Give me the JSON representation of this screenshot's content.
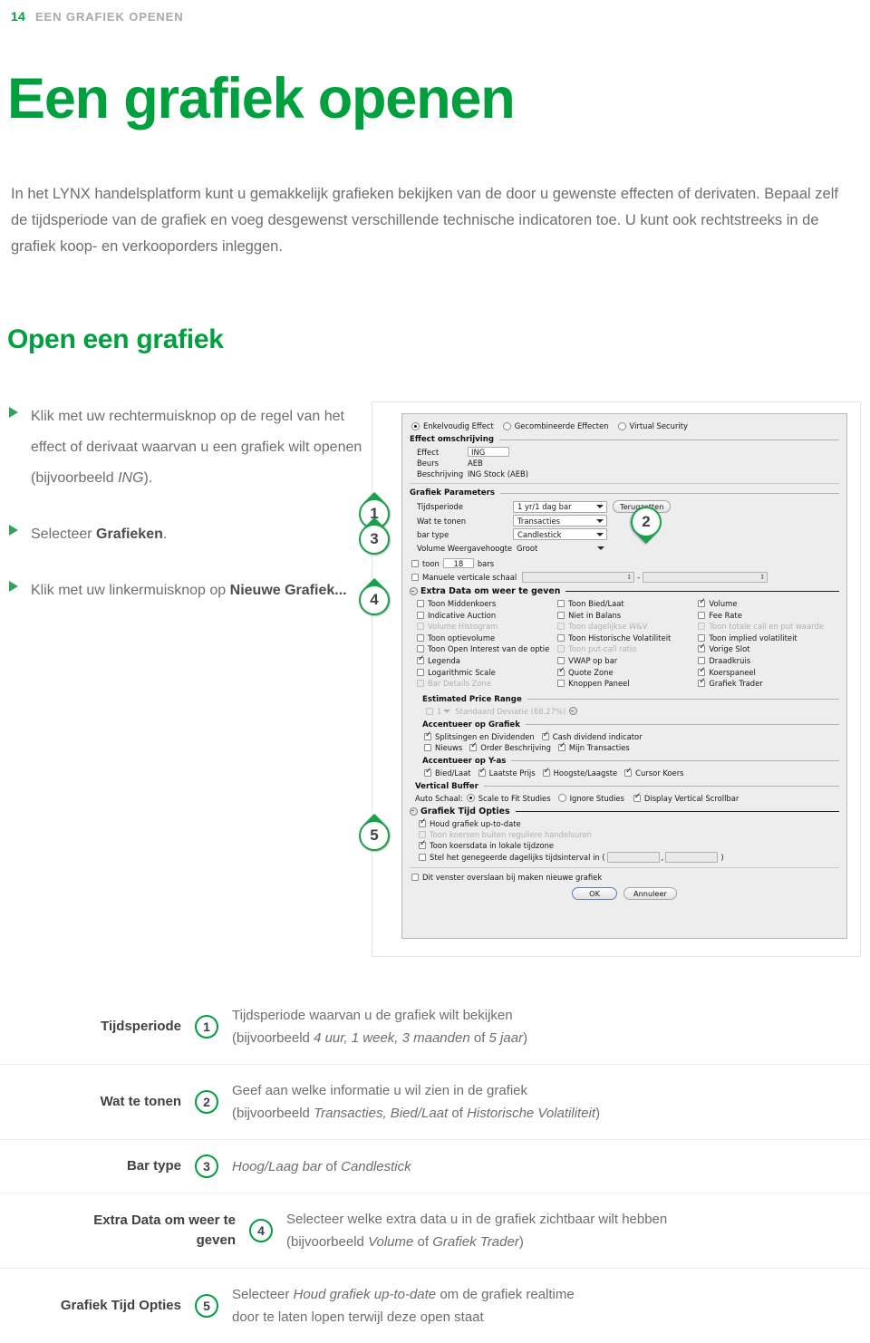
{
  "runhead": {
    "page_number": "14",
    "title": "EEN GRAFIEK OPENEN"
  },
  "page_title": "Een grafiek openen",
  "intro": "In het LYNX handelsplatform kunt u gemakkelijk grafieken bekijken van de door u gewenste effecten of derivaten. Bepaal zelf de tijdsperiode van de grafiek en voeg desgewenst verschillende technische indicatoren toe. U kunt ook rechtstreeks in de grafiek koop- en verkooporders inleggen.",
  "section_head": "Open een grafiek",
  "bullets": [
    {
      "pre": "Klik met uw rechtermuisknop op de regel van het effect of derivaat waarvan u een grafiek wilt openen (bijvoorbeeld ",
      "em": "ING",
      "post": ")."
    },
    {
      "pre": "Selecteer ",
      "strong": "Grafieken",
      "post": "."
    },
    {
      "pre": "Klik met uw linkermuisknop op ",
      "strong": "Nieuwe Grafiek...",
      "post": ""
    }
  ],
  "callouts": [
    {
      "n": "1"
    },
    {
      "n": "2"
    },
    {
      "n": "3"
    },
    {
      "n": "4"
    },
    {
      "n": "5"
    }
  ],
  "dialog": {
    "security_type": {
      "options": [
        "Enkelvoudig Effect",
        "Gecombineerde Effecten",
        "Virtual Security"
      ],
      "selected": "Enkelvoudig Effect"
    },
    "effect_group": {
      "title": "Effect omschrijving",
      "fields": [
        {
          "label": "Effect",
          "value": "ING"
        },
        {
          "label": "Beurs",
          "value": "AEB"
        },
        {
          "label": "Beschrijving",
          "value": "ING Stock (AEB)"
        }
      ]
    },
    "params_group": {
      "title": "Grafiek Parameters",
      "reset_button": "Terugzetten",
      "rows": [
        {
          "label": "Tijdsperiode",
          "value": "1 yr/1 dag bar"
        },
        {
          "label": "Wat te tonen",
          "value": "Transacties"
        },
        {
          "label": "bar type",
          "value": "Candlestick"
        },
        {
          "label": "Volume Weergavehoogte",
          "value": "Groot"
        }
      ],
      "bars_prefix": "toon",
      "bars_value": "18",
      "bars_suffix": "bars",
      "manual_scale": "Manuele verticale schaal",
      "manual_scale_sep": "-"
    },
    "extra_data_group": {
      "title": "Extra Data om weer te geven",
      "col1": [
        {
          "label": "Toon Middenkoers",
          "checked": false,
          "disabled": false
        },
        {
          "label": "Indicative Auction",
          "checked": false,
          "disabled": false
        },
        {
          "label": "Volume Histogram",
          "checked": false,
          "disabled": true
        },
        {
          "label": "Toon optievolume",
          "checked": false,
          "disabled": false
        },
        {
          "label": "Toon Open Interest van de optie",
          "checked": false,
          "disabled": false
        },
        {
          "label": "Legenda",
          "checked": true,
          "disabled": false
        },
        {
          "label": "Logarithmic Scale",
          "checked": false,
          "disabled": false
        },
        {
          "label": "Bar Details Zone",
          "checked": false,
          "disabled": true
        }
      ],
      "col2": [
        {
          "label": "Toon Bied/Laat",
          "checked": false,
          "disabled": false
        },
        {
          "label": "Niet in Balans",
          "checked": false,
          "disabled": false
        },
        {
          "label": "Toon dagelijkse W&V",
          "checked": false,
          "disabled": true
        },
        {
          "label": "Toon Historische Volatiliteit",
          "checked": false,
          "disabled": false
        },
        {
          "label": "Toon put-call ratio",
          "checked": false,
          "disabled": true
        },
        {
          "label": "VWAP op bar",
          "checked": false,
          "disabled": false
        },
        {
          "label": "Quote Zone",
          "checked": true,
          "disabled": false
        },
        {
          "label": "Knoppen Paneel",
          "checked": false,
          "disabled": false
        }
      ],
      "col3": [
        {
          "label": "Volume",
          "checked": true,
          "disabled": false
        },
        {
          "label": "Fee Rate",
          "checked": false,
          "disabled": false
        },
        {
          "label": "Toon totale call en put waarde",
          "checked": false,
          "disabled": true
        },
        {
          "label": "Toon implied volatiliteit",
          "checked": false,
          "disabled": false
        },
        {
          "label": "Vorige Slot",
          "checked": true,
          "disabled": false
        },
        {
          "label": "Draadkruis",
          "checked": false,
          "disabled": false
        },
        {
          "label": "Koerspaneel",
          "checked": true,
          "disabled": false
        },
        {
          "label": "Grafiek Trader",
          "checked": true,
          "disabled": false
        }
      ]
    },
    "estimated_price_range": {
      "title": "Estimated Price Range",
      "value": "1",
      "label": "Standaard Deviatie (68.27%)"
    },
    "accent_chart": {
      "title": "Accentueer op Grafiek",
      "items": [
        {
          "label": "Splitsingen en Dividenden",
          "checked": true
        },
        {
          "label": "Cash dividend indicator",
          "checked": true
        },
        {
          "label": "Nieuws",
          "checked": false
        },
        {
          "label": "Order Beschrijving",
          "checked": true
        },
        {
          "label": "Mijn Transacties",
          "checked": true
        }
      ]
    },
    "accent_yaxis": {
      "title": "Accentueer op Y-as",
      "items": [
        {
          "label": "Bied/Laat",
          "checked": true
        },
        {
          "label": "Laatste Prijs",
          "checked": true
        },
        {
          "label": "Hoogste/Laagste",
          "checked": true
        },
        {
          "label": "Cursor Koers",
          "checked": true
        }
      ]
    },
    "vertical_buffer": {
      "title": "Vertical Buffer",
      "auto_label": "Auto Schaal:",
      "radios": [
        {
          "label": "Scale to Fit Studies",
          "selected": true
        },
        {
          "label": "Ignore Studies",
          "selected": false
        }
      ],
      "scrollbar": {
        "label": "Display Vertical Scrollbar",
        "checked": true
      }
    },
    "time_options": {
      "title": "Grafiek Tijd Opties",
      "items": [
        {
          "label": "Houd grafiek up-to-date",
          "checked": true,
          "disabled": false
        },
        {
          "label": "Toon koersen buiten reguliere handelsuren",
          "checked": false,
          "disabled": true
        },
        {
          "label": "Toon koersdata in lokale tijdzone",
          "checked": true,
          "disabled": false
        }
      ],
      "interval_pre": "Stel het genegeerde dagelijks tijdsinterval in (",
      "interval_mid": ",",
      "interval_post": ")"
    },
    "skip_dialog": "Dit venster overslaan bij maken nieuwe grafiek",
    "buttons": {
      "ok": "OK",
      "cancel": "Annuleer"
    }
  },
  "legend_table": [
    {
      "label": "Tijdsperiode",
      "num": "1",
      "line1_pre": "Tijdsperiode waarvan u de grafiek wilt bekijken",
      "line2_pre": "(bijvoorbeeld ",
      "line2_em": "4 uur, 1 week, 3 maanden",
      "line2_mid": " of ",
      "line2_em2": "5 jaar",
      "line2_post": ")"
    },
    {
      "label": "Wat te tonen",
      "num": "2",
      "line1_pre": "Geef aan welke informatie u wil zien in de grafiek",
      "line2_pre": "(bijvoorbeeld ",
      "line2_em": "Transacties, Bied/Laat",
      "line2_mid": " of ",
      "line2_em2": "Historische Volatiliteit",
      "line2_post": ")"
    },
    {
      "label": "Bar type",
      "num": "3",
      "line1_pre": "",
      "line1_em": "Hoog/Laag bar",
      "line1_mid": " of ",
      "line1_em2": "Candlestick",
      "line1_post": ""
    },
    {
      "label": "Extra Data om weer te geven",
      "num": "4",
      "line1_pre": "Selecteer welke extra data u in de grafiek zichtbaar wilt hebben",
      "line2_pre": "(bijvoorbeeld ",
      "line2_em": "Volume",
      "line2_mid": " of ",
      "line2_em2": "Grafiek Trader",
      "line2_post": ")"
    },
    {
      "label": "Grafiek Tijd Opties",
      "num": "5",
      "line1_pre": "Selecteer ",
      "line1_em": "Houd grafiek up-to-date",
      "line1_post": " om de grafiek realtime",
      "line2_plain": "door te laten lopen terwijl deze open staat"
    }
  ],
  "colors": {
    "brand_green": "#00a03e",
    "callout_green": "#19a04b",
    "body_gray": "#6d6e71",
    "head_gray": "#a7a9ac"
  }
}
